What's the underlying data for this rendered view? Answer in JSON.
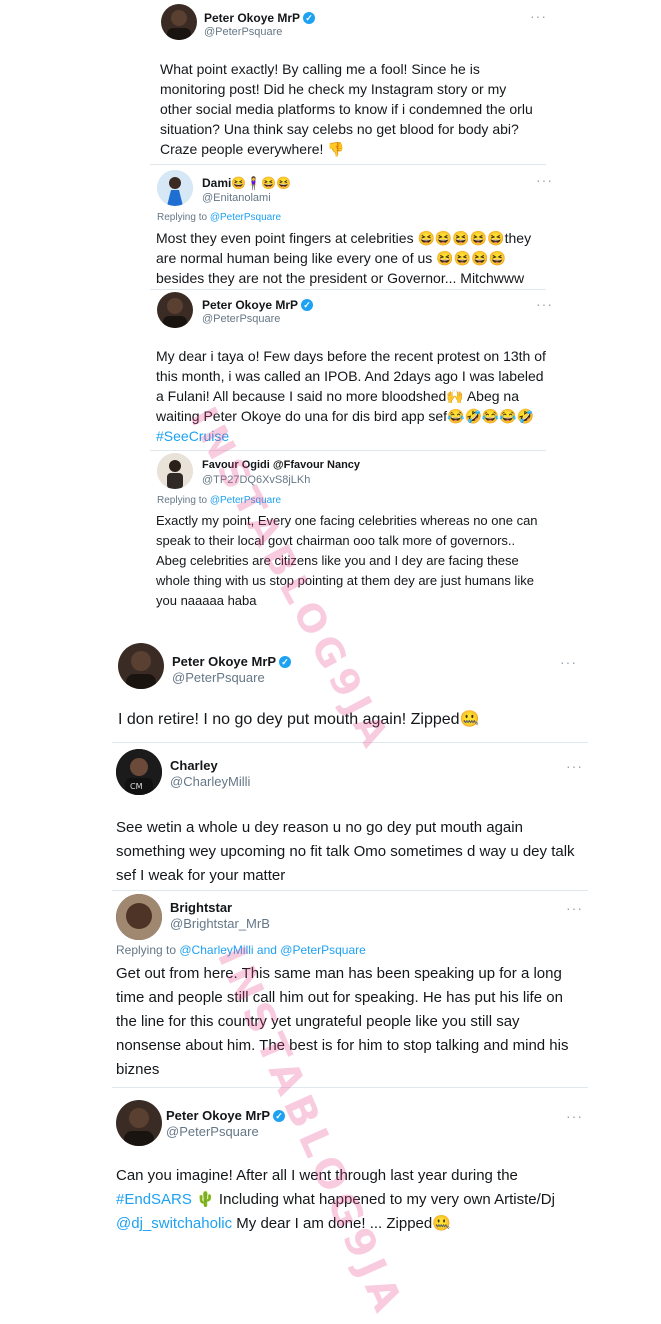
{
  "watermark": "INSTABLOG9JA",
  "top_tweets": [
    {
      "name": "Peter Okoye MrP",
      "handle": "@PeterPsquare",
      "verified": true,
      "body": "What point exactly! By calling me a fool! Since he is monitoring post! Did he check my Instagram story or my other social media platforms to know if i condemned the orlu situation? Una think say celebs no get blood for body abi? Craze people everywhere! 👎"
    },
    {
      "name": "Dami😆🧍‍♀️😆😆",
      "handle": "@Enitanolami",
      "reply_prefix": "Replying to ",
      "reply_to": "@PeterPsquare",
      "body": "Most they even point fingers at celebrities 😆😆😆😆😆they are normal human being like every one of us 😆😆😆😆 besides they are not the president or Governor... Mitchwww"
    },
    {
      "name": "Peter Okoye MrP",
      "handle": "@PeterPsquare",
      "verified": true,
      "body": "My dear i taya o! Few days before the recent protest on 13th of this month, i was called an IPOB. And 2days ago I was labeled a Fulani! All because I said no more bloodshed🙌 Abeg na waiting Peter Okoye do una for dis bird app sef😂🤣😂😂🤣",
      "hashtag": "#SeeCruise"
    },
    {
      "name": "Favour Ogidi @Ffavour Nancy",
      "handle": "@TP27DQ6XvS8jLKh",
      "reply_prefix": "Replying to ",
      "reply_to": "@PeterPsquare",
      "body": "Exactly my point, Every one facing celebrities whereas no one can speak to their local govt chairman ooo talk more of governors.. Abeg celebrities are citizens like you and I dey are facing these whole thing with us stop pointing at them dey are just humans like you naaaaa haba"
    }
  ],
  "bottom_tweets": [
    {
      "name": "Peter Okoye MrP",
      "handle": "@PeterPsquare",
      "verified": true,
      "body": "I don retire! I no go dey put mouth again! Zipped🤐"
    },
    {
      "name": "Charley",
      "handle": "@CharleyMilli",
      "body": "See wetin a whole u dey reason u no go dey put mouth again something wey upcoming no fit talk Omo sometimes d way u dey talk sef I weak for your matter"
    },
    {
      "name": "Brightstar",
      "handle": "@Brightstar_MrB",
      "reply_prefix": "Replying to ",
      "reply_to": "@CharleyMilli and @PeterPsquare",
      "body": "Get out from here. This same man has been speaking up for a long time and people still call him out for speaking. He has put his life on the line for this country yet ungrateful people like you still say nonsense about him. The best is for him to stop talking and mind his biznes"
    },
    {
      "name": "Peter Okoye MrP",
      "handle": "@PeterPsquare",
      "verified": true,
      "body_1": "Can you imagine! After all I went through last year during the ",
      "hashtag": "#EndSARS",
      "body_2": " 🌵 Including what happened to my very own Artiste/Dj ",
      "mention": "@dj_switchaholic",
      "body_3": " My dear I am done! ... Zipped🤐"
    }
  ]
}
